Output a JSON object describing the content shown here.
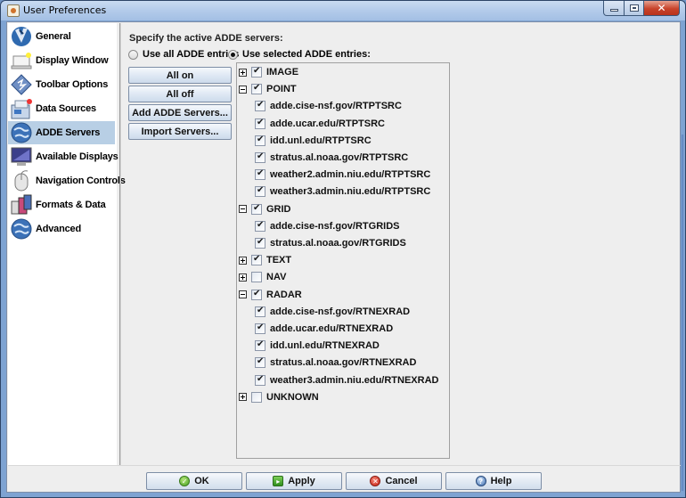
{
  "window": {
    "title": "User Preferences",
    "controls": {
      "minimize": "minimize-icon",
      "maximize": "maximize-icon",
      "close": "close-icon"
    }
  },
  "sidebar": {
    "selected": "ADDE Servers",
    "items": [
      {
        "label": "General",
        "icon": "general-icon"
      },
      {
        "label": "Display Window",
        "icon": "display-window-icon"
      },
      {
        "label": "Toolbar Options",
        "icon": "toolbar-options-icon"
      },
      {
        "label": "Data Sources",
        "icon": "data-sources-icon"
      },
      {
        "label": "ADDE Servers",
        "icon": "globe-icon"
      },
      {
        "label": "Available Displays",
        "icon": "monitor-icon"
      },
      {
        "label": "Navigation Controls",
        "icon": "mouse-icon"
      },
      {
        "label": "Formats & Data",
        "icon": "formats-icon"
      },
      {
        "label": "Advanced",
        "icon": "globe-icon"
      }
    ]
  },
  "main": {
    "heading": "Specify the active ADDE servers:",
    "radios": [
      {
        "label": "Use all ADDE entries",
        "checked": false
      },
      {
        "label": "Use selected ADDE entries:",
        "checked": true
      }
    ],
    "buttons": {
      "all_on": "All on",
      "all_off": "All off",
      "add_servers": "Add ADDE Servers...",
      "import_servers": "Import Servers..."
    },
    "tree": [
      {
        "label": "IMAGE",
        "level": 0,
        "expanded": false,
        "checked": true
      },
      {
        "label": "POINT",
        "level": 0,
        "expanded": true,
        "checked": true
      },
      {
        "label": "adde.cise-nsf.gov/RTPTSRC",
        "level": 1,
        "checked": true
      },
      {
        "label": "adde.ucar.edu/RTPTSRC",
        "level": 1,
        "checked": true
      },
      {
        "label": "idd.unl.edu/RTPTSRC",
        "level": 1,
        "checked": true
      },
      {
        "label": "stratus.al.noaa.gov/RTPTSRC",
        "level": 1,
        "checked": true
      },
      {
        "label": "weather2.admin.niu.edu/RTPTSRC",
        "level": 1,
        "checked": true
      },
      {
        "label": "weather3.admin.niu.edu/RTPTSRC",
        "level": 1,
        "checked": true
      },
      {
        "label": "GRID",
        "level": 0,
        "expanded": true,
        "checked": true
      },
      {
        "label": "adde.cise-nsf.gov/RTGRIDS",
        "level": 1,
        "checked": true
      },
      {
        "label": "stratus.al.noaa.gov/RTGRIDS",
        "level": 1,
        "checked": true
      },
      {
        "label": "TEXT",
        "level": 0,
        "expanded": false,
        "checked": true
      },
      {
        "label": "NAV",
        "level": 0,
        "expanded": false,
        "checked": false
      },
      {
        "label": "RADAR",
        "level": 0,
        "expanded": true,
        "checked": true
      },
      {
        "label": "adde.cise-nsf.gov/RTNEXRAD",
        "level": 1,
        "checked": true
      },
      {
        "label": "adde.ucar.edu/RTNEXRAD",
        "level": 1,
        "checked": true
      },
      {
        "label": "idd.unl.edu/RTNEXRAD",
        "level": 1,
        "checked": true
      },
      {
        "label": "stratus.al.noaa.gov/RTNEXRAD",
        "level": 1,
        "checked": true
      },
      {
        "label": "weather3.admin.niu.edu/RTNEXRAD",
        "level": 1,
        "checked": true
      },
      {
        "label": "UNKNOWN",
        "level": 0,
        "expanded": false,
        "checked": false
      }
    ]
  },
  "footer": {
    "ok": "OK",
    "apply": "Apply",
    "cancel": "Cancel",
    "help": "Help"
  }
}
